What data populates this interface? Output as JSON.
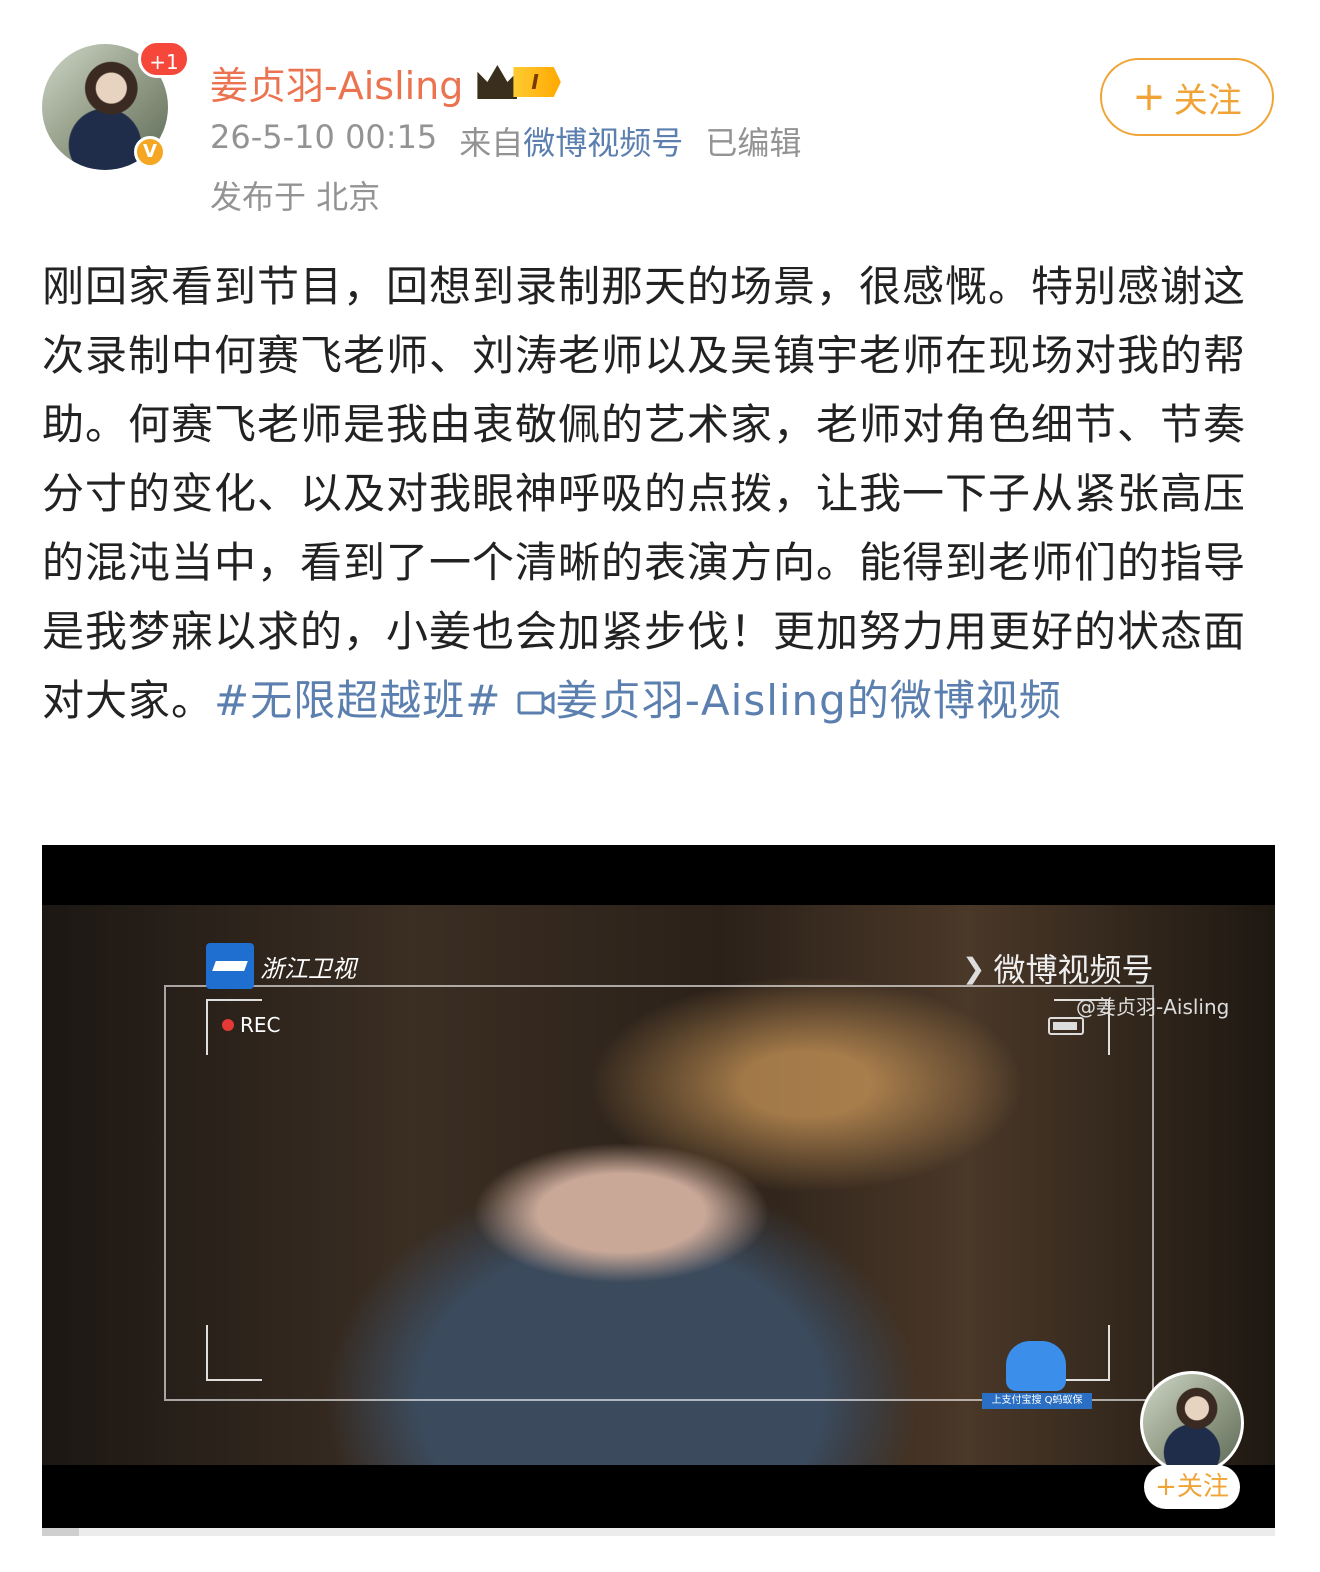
{
  "header": {
    "notification_badge": "+1",
    "verified_badge": "V",
    "username": "姜贞羽-Aisling",
    "vip_level": "I",
    "timestamp": "26-5-10 00:15",
    "source_prefix": "来自",
    "source_name": "微博视频号",
    "edited": "已编辑",
    "location": "发布于 北京",
    "follow_label": "关注"
  },
  "post": {
    "body": "刚回家看到节目，回想到录制那天的场景，很感慨。特别感谢这次录制中何赛飞老师、刘涛老师以及吴镇宇老师在现场对我的帮助。何赛飞老师是我由衷敬佩的艺术家，老师对角色细节、节奏分寸的变化、以及对我眼神呼吸的点拨，让我一下子从紧张高压的混沌当中，看到了一个清晰的表演方向。能得到老师们的指导是我梦寐以求的，小姜也会加紧步伐！更加努力用更好的状态面对大家。",
    "hashtag": "#无限超越班#",
    "video_link_icon": "video-icon",
    "video_link": "姜贞羽-Aisling的微博视频"
  },
  "video": {
    "channel_name": "浙江卫视",
    "rec_label": "REC",
    "watermark": "微博视频号",
    "watermark_user": "@姜贞羽-Aisling",
    "sponsor_label": "上支付宝搜 Q蚂蚁保",
    "follow_label": "+关注",
    "progress": 0.03
  },
  "colors": {
    "username": "#eb7350",
    "link": "#5b7faf",
    "follow": "#f0a437"
  }
}
